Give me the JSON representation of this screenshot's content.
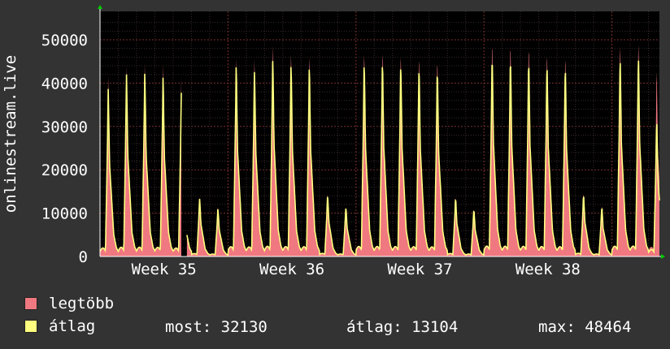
{
  "chart_data": {
    "type": "area",
    "ylabel": "onlinestream.live",
    "ylim": [
      0,
      55000
    ],
    "yticks": [
      0,
      10000,
      20000,
      30000,
      40000,
      50000
    ],
    "xticks": [
      {
        "label": "Week 35",
        "day": 3.5
      },
      {
        "label": "Week 36",
        "day": 10.5
      },
      {
        "label": "Week 37",
        "day": 17.5
      },
      {
        "label": "Week 38",
        "day": 24.5
      }
    ],
    "days": 30.6,
    "gap": [
      4.45,
      4.75
    ],
    "daily_peaks": {
      "max": [
        42000,
        44500,
        45200,
        45100,
        42300,
        14100,
        11800,
        46900,
        47000,
        50500,
        48500,
        48000,
        15000,
        12000,
        48900,
        49200,
        48600,
        48000,
        47200,
        14300,
        11500,
        51500,
        51000,
        50500,
        49000,
        48200,
        15200,
        12200,
        51000,
        51400,
        44500
      ],
      "avg": [
        39000,
        42500,
        42800,
        42000,
        38600,
        13600,
        11200,
        45000,
        44000,
        46800,
        45500,
        45000,
        14400,
        11600,
        46000,
        46200,
        45800,
        45000,
        44300,
        13800,
        11100,
        47500,
        47000,
        46500,
        45800,
        45000,
        14600,
        11700,
        47000,
        47500,
        32000
      ]
    },
    "series": [
      {
        "name": "legtöbb",
        "color": "#f07880"
      },
      {
        "name": "átlag",
        "color": "#ffff80"
      }
    ],
    "grid": true,
    "background": "#000000"
  },
  "legend": {
    "max_label": "legtöbb",
    "avg_label": "átlag",
    "max_color": "#f07880",
    "avg_color": "#ffff80"
  },
  "stats": {
    "current": "most: 32130",
    "average": "átlag: 13104",
    "maximum": "max: 48464"
  }
}
